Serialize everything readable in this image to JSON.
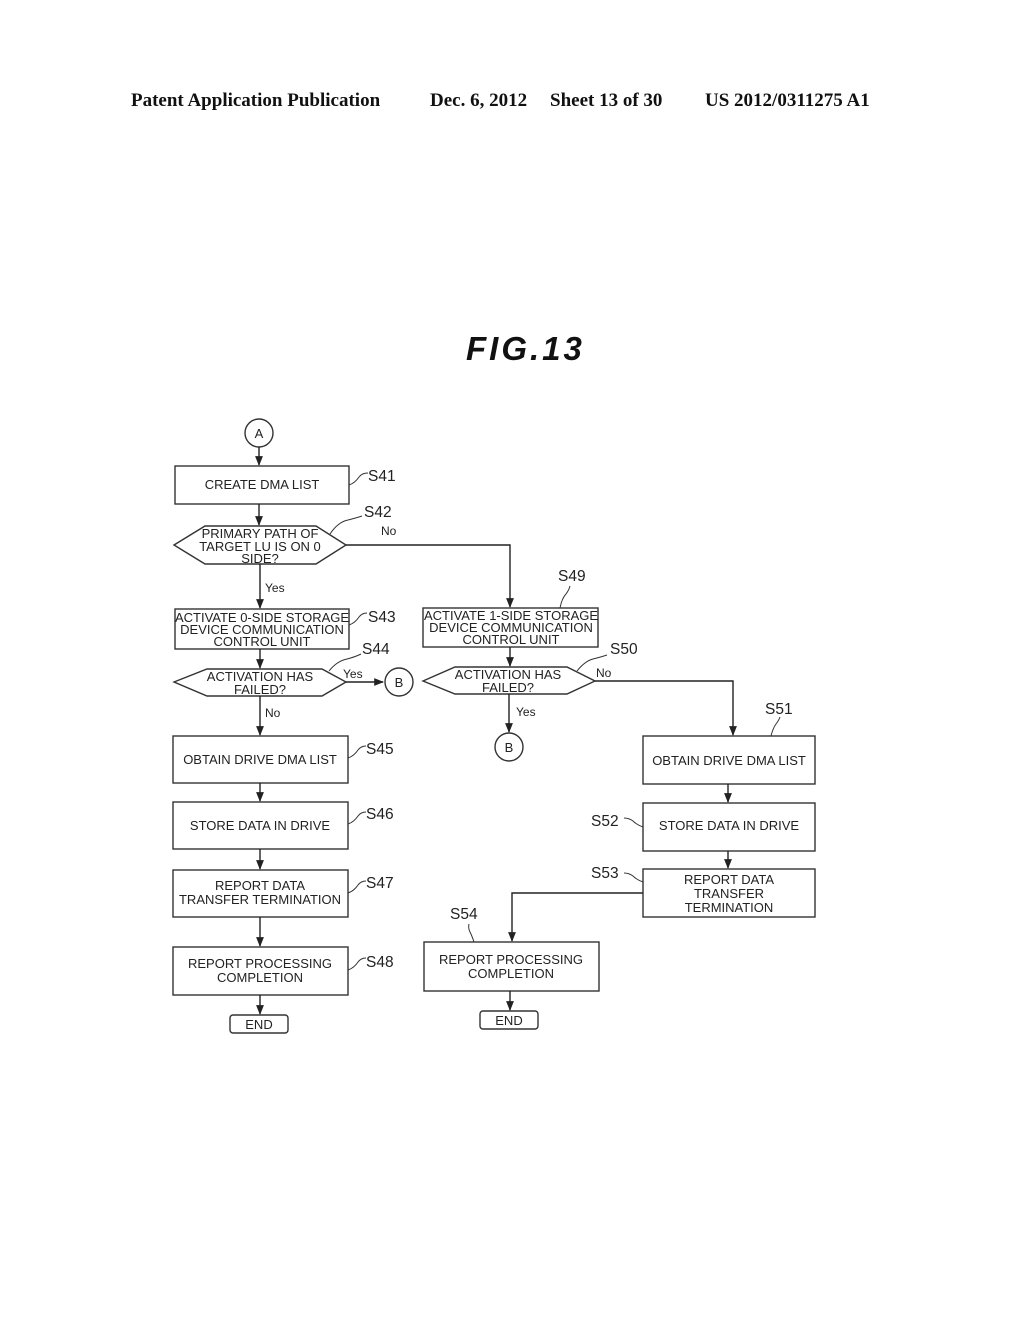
{
  "header": {
    "publication": "Patent Application Publication",
    "date": "Dec. 6, 2012",
    "sheet": "Sheet 13 of 30",
    "number": "US 2012/0311275 A1"
  },
  "figure_title": "FIG.13",
  "connectors": {
    "a": "A",
    "b1": "B",
    "b2": "B"
  },
  "steps": {
    "s41": {
      "id": "S41",
      "lines": [
        "CREATE DMA LIST"
      ]
    },
    "s42": {
      "id": "S42",
      "lines": [
        "PRIMARY PATH OF",
        "TARGET LU IS ON 0",
        "SIDE?"
      ]
    },
    "s43": {
      "id": "S43",
      "lines": [
        "ACTIVATE 0-SIDE STORAGE",
        "DEVICE COMMUNICATION",
        "CONTROL UNIT"
      ]
    },
    "s44": {
      "id": "S44",
      "lines": [
        "ACTIVATION HAS",
        "FAILED?"
      ]
    },
    "s45": {
      "id": "S45",
      "lines": [
        "OBTAIN DRIVE DMA LIST"
      ]
    },
    "s46": {
      "id": "S46",
      "lines": [
        "STORE DATA IN DRIVE"
      ]
    },
    "s47": {
      "id": "S47",
      "lines": [
        "REPORT DATA",
        "TRANSFER TERMINATION"
      ]
    },
    "s48": {
      "id": "S48",
      "lines": [
        "REPORT PROCESSING",
        "COMPLETION"
      ]
    },
    "s49": {
      "id": "S49",
      "lines": [
        "ACTIVATE 1-SIDE STORAGE",
        "DEVICE COMMUNICATION",
        "CONTROL UNIT"
      ]
    },
    "s50": {
      "id": "S50",
      "lines": [
        "ACTIVATION HAS",
        "FAILED?"
      ]
    },
    "s51": {
      "id": "S51",
      "lines": [
        "OBTAIN DRIVE DMA LIST"
      ]
    },
    "s52": {
      "id": "S52",
      "lines": [
        "STORE DATA IN DRIVE"
      ]
    },
    "s53": {
      "id": "S53",
      "lines": [
        "REPORT DATA",
        "TRANSFER",
        "TERMINATION"
      ]
    },
    "s54": {
      "id": "S54",
      "lines": [
        "REPORT PROCESSING",
        "COMPLETION"
      ]
    }
  },
  "end_labels": {
    "left": "END",
    "right": "END"
  },
  "branch_labels": {
    "s42_no": "No",
    "s42_yes": "Yes",
    "s44_yes": "Yes",
    "s44_no": "No",
    "s50_no": "No",
    "s50_yes": "Yes"
  }
}
